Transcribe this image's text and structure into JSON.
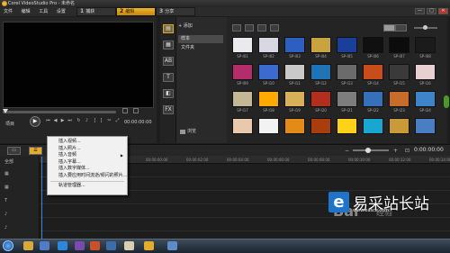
{
  "window": {
    "title": "Corel VideoStudio Pro - 未命名",
    "min_label": "—",
    "max_label": "□",
    "close_label": "✕"
  },
  "menu": [
    "文件",
    "编辑",
    "工具",
    "设置"
  ],
  "tabs": [
    {
      "num": "1",
      "label": "捕获",
      "active": false
    },
    {
      "num": "2",
      "label": "编辑",
      "active": true
    },
    {
      "num": "3",
      "label": "分享",
      "active": false
    }
  ],
  "player": {
    "project_label": "项目",
    "clip_label": "素材",
    "timecode": "00:00:00:00",
    "play_icon": "▶",
    "progress_fraction": 0.0
  },
  "library": {
    "add_label": "+ 添加",
    "folders": [
      {
        "label": "样本",
        "selected": true
      },
      {
        "label": "文件夹",
        "selected": false
      }
    ],
    "browse_label": "浏览",
    "thumbnails": [
      {
        "label": "SP-I01",
        "color": "#e9e9ee"
      },
      {
        "label": "SP-I02",
        "color": "#d8d8e3"
      },
      {
        "label": "SP-I03",
        "color": "#2d5fc0"
      },
      {
        "label": "SP-I04",
        "color": "#c8a440"
      },
      {
        "label": "SP-I05",
        "color": "#1a3f9a"
      },
      {
        "label": "SP-I06",
        "color": "#101010"
      },
      {
        "label": "SP-I07",
        "color": "#0c0c0c"
      },
      {
        "label": "SP-I08",
        "color": "#1b1b1b"
      },
      {
        "label": "SP-I09",
        "color": "#b12e6a"
      },
      {
        "label": "SP-I10",
        "color": "#3c6bd0"
      },
      {
        "label": "SP-I11",
        "color": "#c9c9c9"
      },
      {
        "label": "SP-I12",
        "color": "#1f74b7"
      },
      {
        "label": "SP-I13",
        "color": "#6b6b6b"
      },
      {
        "label": "SP-I14",
        "color": "#c84d1a"
      },
      {
        "label": "SP-I15",
        "color": "#3a3a3a"
      },
      {
        "label": "SP-I16",
        "color": "#e8d0d0"
      },
      {
        "label": "SP-I17",
        "color": "#c4b796"
      },
      {
        "label": "SP-I18",
        "color": "#ffaa00"
      },
      {
        "label": "SP-I19",
        "color": "#d9b05a"
      },
      {
        "label": "SP-I20",
        "color": "#b12f1c"
      },
      {
        "label": "SP-I21",
        "color": "#7d7d7d"
      },
      {
        "label": "SP-I22",
        "color": "#3471b8"
      },
      {
        "label": "SP-I23",
        "color": "#c86c2a"
      },
      {
        "label": "SP-I24",
        "color": "#3d85c8"
      },
      {
        "label": "SP-I25",
        "color": "#e8c9ac"
      },
      {
        "label": "SP-I26",
        "color": "#f2f2f2"
      },
      {
        "label": "SP-I27",
        "color": "#e48a16"
      },
      {
        "label": "SP-I28",
        "color": "#a83d0e"
      },
      {
        "label": "SP-I29",
        "color": "#ffd21a"
      },
      {
        "label": "SP-I30",
        "color": "#19a7d1"
      },
      {
        "label": "SP-I31",
        "color": "#c89a38"
      },
      {
        "label": "SP-I32",
        "color": "#4a7ec2"
      }
    ],
    "side_icons": [
      "media-icon",
      "instant-project-icon",
      "transition-icon",
      "title-icon",
      "graphic-icon",
      "filter-icon"
    ],
    "side_glyphs": [
      "▤",
      "▦",
      "AB",
      "T",
      "◧",
      "FX"
    ]
  },
  "timeline": {
    "timecode": "0:00:00:00",
    "ruler": [
      "00:00:00:00",
      "00:00:02:00",
      "00:00:04:00",
      "00:00:06:00",
      "00:00:08:00",
      "00:00:10:00",
      "00:00:12:00",
      "00:00:14:00",
      "00:00:16:00",
      "00:00:18:00"
    ],
    "track_icons": [
      "▦",
      "▦",
      "T",
      "♪",
      "♪"
    ]
  },
  "context_menu": [
    {
      "label": "插入视频...",
      "submenu": false
    },
    {
      "label": "插入照片...",
      "submenu": false
    },
    {
      "label": "插入音频",
      "submenu": true
    },
    {
      "label": "插入字幕...",
      "submenu": false
    },
    {
      "label": "插入数字媒体...",
      "submenu": false
    },
    {
      "label": "插入要应用时间流逝/频闪的照片...",
      "submenu": false
    },
    {
      "label": "轨道管理器...",
      "submenu": false
    }
  ],
  "watermark": {
    "site_name": "易采站长站",
    "url": "www.easck.com",
    "baidu": "Bai",
    "jingyan": "经验"
  },
  "colors": {
    "accent": "#e3ac2d",
    "playhead": "#3c87d6"
  }
}
